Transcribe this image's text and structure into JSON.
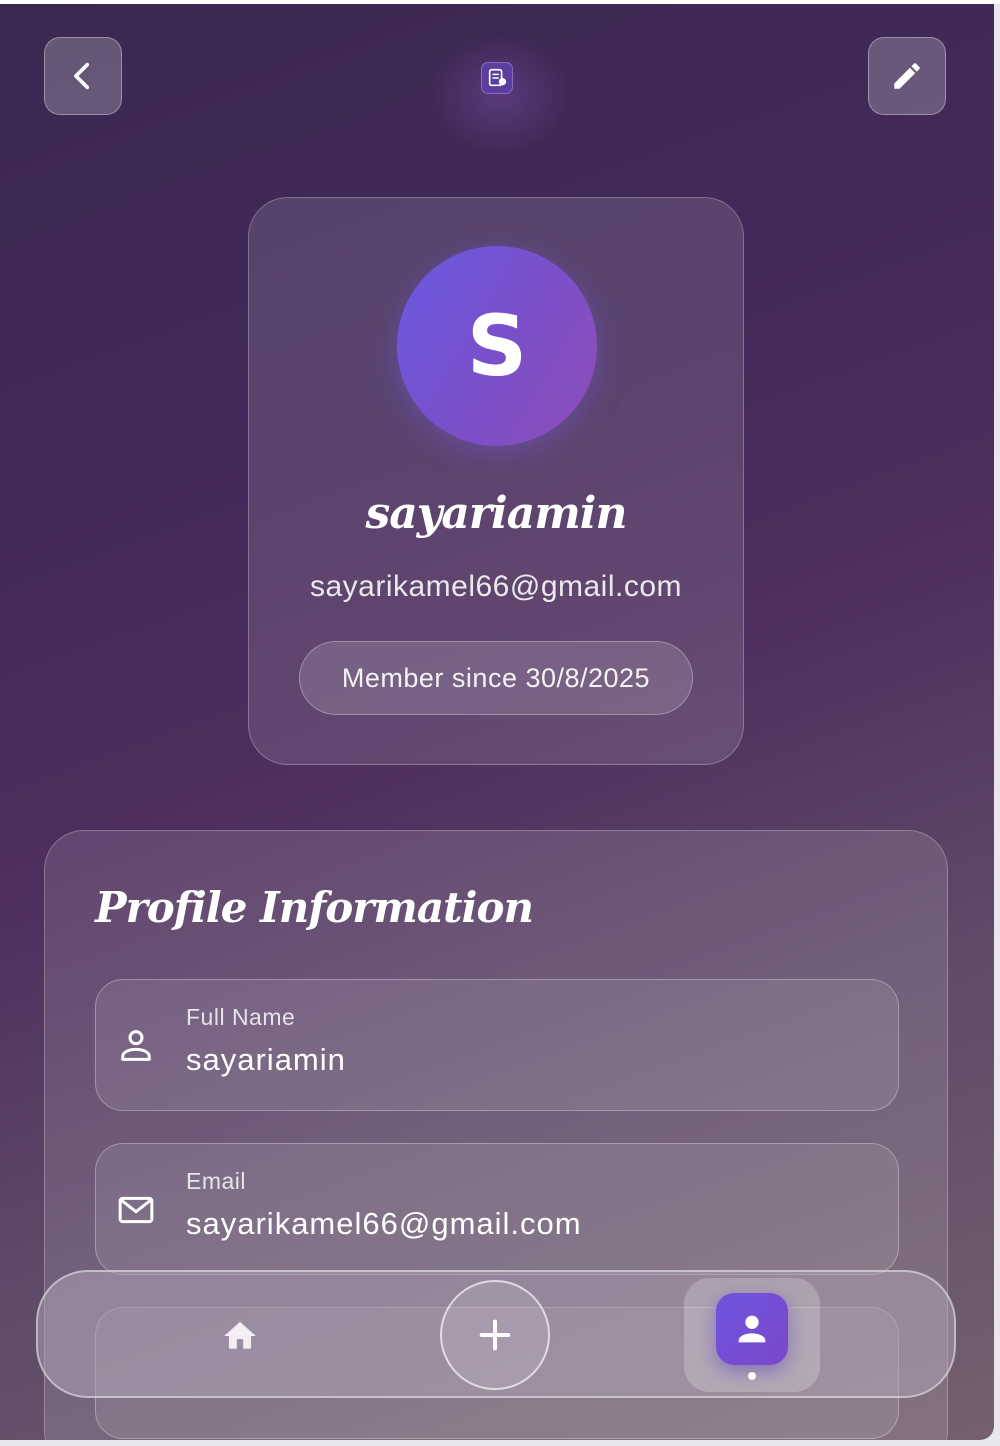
{
  "header": {
    "back_icon": "chevron-left-icon",
    "logo_icon": "app-logo-icon",
    "edit_icon": "pencil-icon"
  },
  "profile": {
    "avatar_initial": "S",
    "username": "sayariamin",
    "email": "sayarikamel66@gmail.com",
    "member_since": "Member since 30/8/2025"
  },
  "info": {
    "title": "Profile Information",
    "fields": [
      {
        "icon": "person-icon",
        "label": "Full Name",
        "value": "sayariamin"
      },
      {
        "icon": "mail-icon",
        "label": "Email",
        "value": "sayarikamel66@gmail.com"
      }
    ]
  },
  "nav": {
    "items": [
      {
        "icon": "home-icon",
        "active": false
      },
      {
        "icon": "plus-icon",
        "active": false
      },
      {
        "icon": "person-icon",
        "active": true
      }
    ]
  },
  "colors": {
    "accent": "#6e54df",
    "avatar_gradient_start": "#6a5ae0",
    "avatar_gradient_end": "#8e4fb6",
    "background_top": "#3b2850",
    "background_bottom": "#74606f"
  }
}
